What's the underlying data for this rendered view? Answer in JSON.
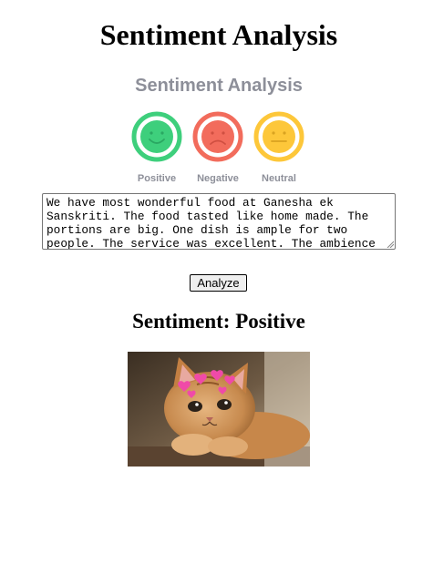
{
  "page": {
    "title": "Sentiment Analysis"
  },
  "logo": {
    "title": "Sentiment Analysis",
    "faces": [
      {
        "label": "Positive",
        "color": "#3ecf7c",
        "icon": "smiling-face-icon"
      },
      {
        "label": "Negative",
        "color": "#f26c5c",
        "icon": "frowning-face-icon"
      },
      {
        "label": "Neutral",
        "color": "#fdc73a",
        "icon": "neutral-face-icon"
      }
    ]
  },
  "form": {
    "review_text": "We have most wonderful food at Ganesha ek Sanskriti. The food tasted like home made. The portions are big. One dish is ample for two people. The service was excellent. The ambience is good.",
    "analyze_label": "Analyze"
  },
  "result": {
    "heading": "Sentiment: Positive",
    "image": "cat-with-hearts"
  }
}
